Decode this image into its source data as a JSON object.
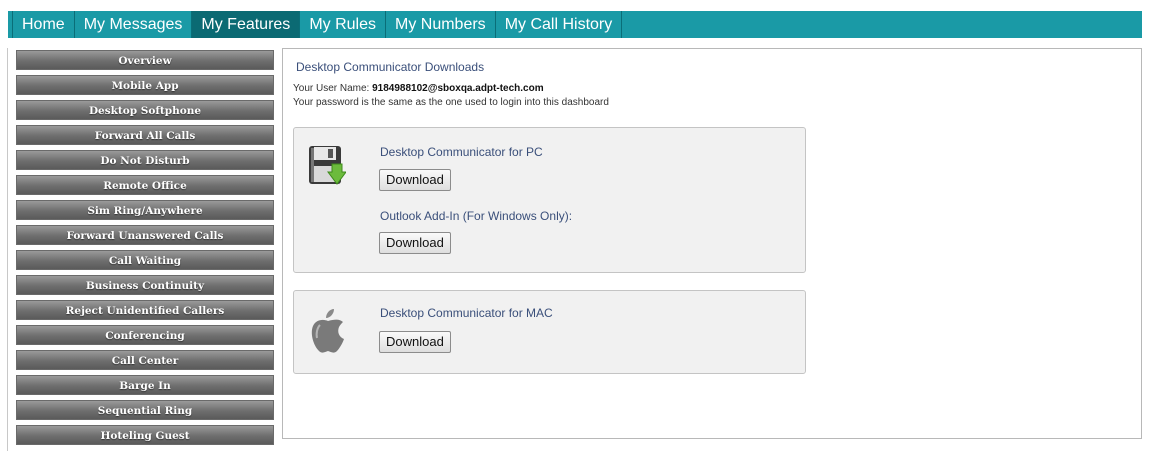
{
  "nav": {
    "tabs": [
      {
        "label": "Home"
      },
      {
        "label": "My Messages"
      },
      {
        "label": "My Features"
      },
      {
        "label": "My Rules"
      },
      {
        "label": "My Numbers"
      },
      {
        "label": "My Call History"
      }
    ],
    "active": "My Features"
  },
  "sidebar": {
    "items": [
      {
        "label": "Overview"
      },
      {
        "label": "Mobile App"
      },
      {
        "label": "Desktop Softphone"
      },
      {
        "label": "Forward All Calls"
      },
      {
        "label": "Do Not Disturb"
      },
      {
        "label": "Remote Office"
      },
      {
        "label": "Sim Ring/Anywhere"
      },
      {
        "label": "Forward Unanswered Calls"
      },
      {
        "label": "Call Waiting"
      },
      {
        "label": "Business Continuity"
      },
      {
        "label": "Reject Unidentified Callers"
      },
      {
        "label": "Conferencing"
      },
      {
        "label": "Call Center"
      },
      {
        "label": "Barge In"
      },
      {
        "label": "Sequential Ring"
      },
      {
        "label": "Hoteling Guest"
      }
    ]
  },
  "main": {
    "title": "Desktop Communicator Downloads",
    "username_label": "Your User Name: ",
    "username": "9184988102@sboxqa.adpt-tech.com",
    "password_note": "Your password is the same as the one used to login into this dashboard",
    "pc_card": {
      "icon": "floppy-disk-download-icon",
      "label": "Desktop Communicator for PC",
      "button": "Download",
      "outlook_label": "Outlook Add-In (For Windows Only):",
      "outlook_button": "Download"
    },
    "mac_card": {
      "icon": "apple-icon",
      "label": "Desktop Communicator for MAC",
      "button": "Download"
    }
  },
  "colors": {
    "nav_bg": "#1a9aa6",
    "nav_active": "#0b6a73",
    "sidebar_btn": "#7a7a7a",
    "link_text": "#3a4f7a"
  }
}
